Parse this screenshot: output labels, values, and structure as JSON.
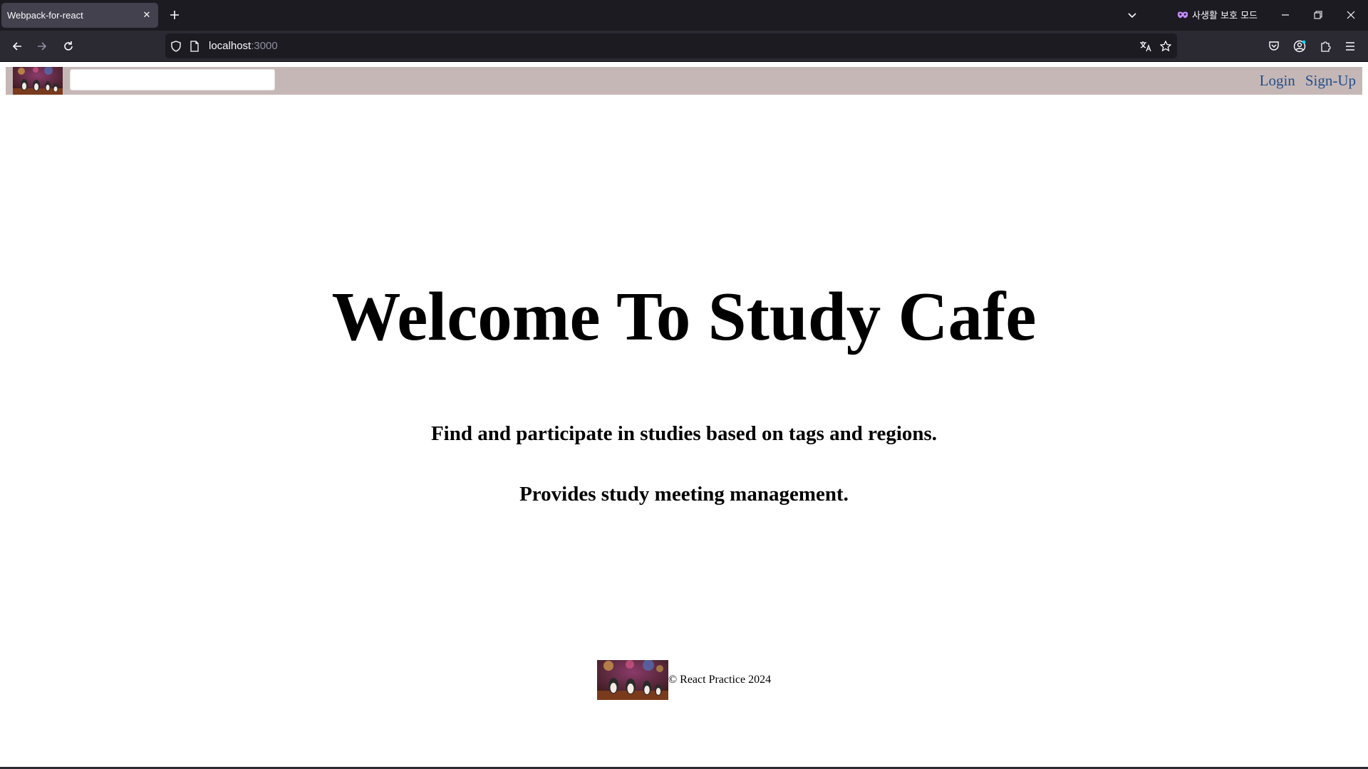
{
  "browser": {
    "tab_title": "Webpack-for-react",
    "tab_close": "✕",
    "private_mode_label": "사생활 보호 모드",
    "url_host": "localhost",
    "url_port": ":3000"
  },
  "header": {
    "login_label": "Login",
    "signup_label": "Sign-Up",
    "search_placeholder": ""
  },
  "hero": {
    "title": "Welcome To Study Cafe",
    "line1": "Find and participate in studies based on tags and regions.",
    "line2": "Provides study meeting management."
  },
  "footer": {
    "text": "© React Practice 2024"
  },
  "icons": {
    "logo": "penguins-photo",
    "new_tab": "plus-icon",
    "tab_list": "chevron-down-icon",
    "back": "arrow-left-icon",
    "forward": "arrow-right-icon",
    "reload": "reload-icon",
    "shield": "shield-icon",
    "page": "page-icon",
    "translate": "translate-icon",
    "bookmark": "star-icon",
    "pocket": "pocket-icon",
    "account": "account-icon",
    "extensions": "puzzle-icon",
    "menu": "hamburger-icon"
  },
  "colors": {
    "header_bg": "#c6b7b7",
    "link": "#1f4f8b",
    "chrome_dark": "#1c1b22",
    "chrome_toolbar": "#2b2a33"
  }
}
